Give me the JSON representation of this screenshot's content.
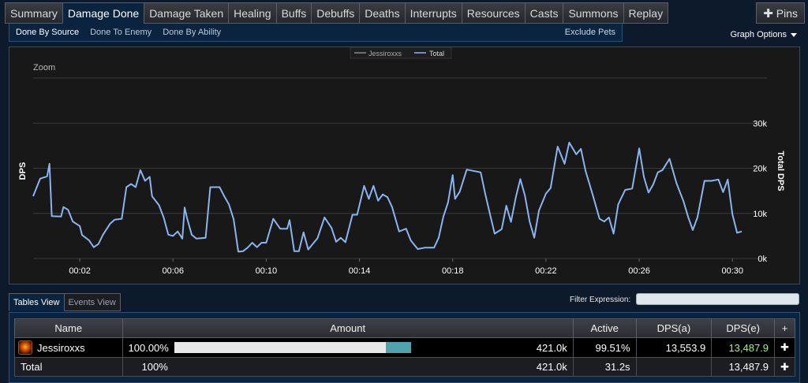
{
  "tabs": [
    "Summary",
    "Damage Done",
    "Damage Taken",
    "Healing",
    "Buffs",
    "Debuffs",
    "Deaths",
    "Interrupts",
    "Resources",
    "Casts",
    "Summons",
    "Replay"
  ],
  "active_tab": "Damage Done",
  "pins_label": "Pins",
  "subtabs": [
    "Done By Source",
    "Done To Enemy",
    "Done By Ability"
  ],
  "exclude_pets": "Exclude Pets",
  "graph_options": "Graph Options",
  "legend": [
    "Jessiroxxs",
    "Total"
  ],
  "zoom_label": "Zoom",
  "colors": {
    "total": "#8ab4f0",
    "jessiroxxs": "#888888",
    "accent": "#0a2440",
    "dps_e": "#a7f07a",
    "bar": "#4ea3ad"
  },
  "chart_data": {
    "type": "line",
    "ylabel": "DPS",
    "y2label": "Total DPS",
    "x_ticks": [
      "00:02",
      "00:06",
      "00:10",
      "00:14",
      "00:18",
      "00:22",
      "00:26",
      "00:30"
    ],
    "y_ticks": [
      "0k",
      "10k",
      "20k",
      "30k"
    ],
    "ylim": [
      0,
      40000
    ],
    "xlim": [
      0,
      30.5
    ],
    "series": [
      {
        "name": "Total",
        "points": [
          [
            0,
            13800
          ],
          [
            0.3,
            17700
          ],
          [
            0.6,
            18200
          ],
          [
            0.7,
            21000
          ],
          [
            0.8,
            9400
          ],
          [
            1.2,
            9300
          ],
          [
            1.3,
            11400
          ],
          [
            1.5,
            10800
          ],
          [
            1.7,
            8200
          ],
          [
            2.0,
            7200
          ],
          [
            2.1,
            5200
          ],
          [
            2.4,
            4000
          ],
          [
            2.6,
            2500
          ],
          [
            2.8,
            3200
          ],
          [
            3.0,
            5300
          ],
          [
            3.3,
            7700
          ],
          [
            3.5,
            8600
          ],
          [
            3.8,
            8800
          ],
          [
            4.0,
            15800
          ],
          [
            4.2,
            16500
          ],
          [
            4.4,
            15800
          ],
          [
            4.6,
            19600
          ],
          [
            4.8,
            17200
          ],
          [
            5.0,
            18100
          ],
          [
            5.1,
            13800
          ],
          [
            5.4,
            11800
          ],
          [
            5.6,
            9100
          ],
          [
            5.8,
            5300
          ],
          [
            6.0,
            5000
          ],
          [
            6.2,
            6000
          ],
          [
            6.4,
            4400
          ],
          [
            6.5,
            11300
          ],
          [
            6.6,
            9000
          ],
          [
            6.8,
            5300
          ],
          [
            7.0,
            4400
          ],
          [
            7.4,
            4600
          ],
          [
            7.6,
            15800
          ],
          [
            7.8,
            15800
          ],
          [
            8.0,
            15800
          ],
          [
            8.2,
            13800
          ],
          [
            8.4,
            12000
          ],
          [
            8.6,
            8700
          ],
          [
            8.8,
            1500
          ],
          [
            9.0,
            1600
          ],
          [
            9.2,
            2400
          ],
          [
            9.4,
            3500
          ],
          [
            9.6,
            2500
          ],
          [
            9.8,
            3500
          ],
          [
            10.0,
            3500
          ],
          [
            10.3,
            8800
          ],
          [
            10.6,
            6600
          ],
          [
            10.9,
            6600
          ],
          [
            11.0,
            8500
          ],
          [
            11.2,
            1600
          ],
          [
            11.4,
            1600
          ],
          [
            11.6,
            5800
          ],
          [
            11.8,
            2000
          ],
          [
            12.2,
            4500
          ],
          [
            12.5,
            9100
          ],
          [
            12.8,
            6800
          ],
          [
            13.0,
            3700
          ],
          [
            13.2,
            4600
          ],
          [
            13.4,
            3600
          ],
          [
            13.7,
            9700
          ],
          [
            13.9,
            9700
          ],
          [
            14.2,
            16100
          ],
          [
            14.4,
            13200
          ],
          [
            14.6,
            16100
          ],
          [
            14.8,
            12800
          ],
          [
            15.0,
            14200
          ],
          [
            15.2,
            13600
          ],
          [
            15.4,
            11400
          ],
          [
            15.7,
            6000
          ],
          [
            16.0,
            6600
          ],
          [
            16.2,
            4000
          ],
          [
            16.5,
            2100
          ],
          [
            16.8,
            2400
          ],
          [
            17.2,
            2400
          ],
          [
            17.4,
            4600
          ],
          [
            17.6,
            9300
          ],
          [
            17.8,
            12400
          ],
          [
            18.0,
            18500
          ],
          [
            18.1,
            13200
          ],
          [
            18.3,
            14800
          ],
          [
            18.6,
            19700
          ],
          [
            19.2,
            19100
          ],
          [
            19.4,
            14200
          ],
          [
            19.6,
            9800
          ],
          [
            19.8,
            5500
          ],
          [
            20.1,
            6500
          ],
          [
            20.3,
            11700
          ],
          [
            20.5,
            8100
          ],
          [
            20.7,
            13400
          ],
          [
            20.9,
            17600
          ],
          [
            21.1,
            13900
          ],
          [
            21.3,
            8200
          ],
          [
            21.5,
            4600
          ],
          [
            21.7,
            10600
          ],
          [
            22.0,
            14400
          ],
          [
            22.2,
            15600
          ],
          [
            22.5,
            24800
          ],
          [
            22.8,
            21000
          ],
          [
            23.0,
            25700
          ],
          [
            23.3,
            23100
          ],
          [
            23.5,
            24300
          ],
          [
            23.7,
            19400
          ],
          [
            24.0,
            14200
          ],
          [
            24.3,
            8800
          ],
          [
            24.5,
            8200
          ],
          [
            24.7,
            9100
          ],
          [
            24.9,
            5500
          ],
          [
            25.1,
            12000
          ],
          [
            25.4,
            15200
          ],
          [
            25.7,
            15500
          ],
          [
            26.0,
            24400
          ],
          [
            26.2,
            18100
          ],
          [
            26.4,
            14600
          ],
          [
            26.6,
            16400
          ],
          [
            26.8,
            19100
          ],
          [
            27.0,
            19600
          ],
          [
            27.3,
            22100
          ],
          [
            27.6,
            16700
          ],
          [
            27.9,
            12700
          ],
          [
            28.1,
            9200
          ],
          [
            28.3,
            6300
          ],
          [
            28.5,
            9100
          ],
          [
            28.8,
            17200
          ],
          [
            29.1,
            17200
          ],
          [
            29.4,
            17500
          ],
          [
            29.6,
            14700
          ],
          [
            29.8,
            17500
          ],
          [
            30.0,
            9800
          ],
          [
            30.2,
            5700
          ],
          [
            30.4,
            6000
          ]
        ]
      }
    ]
  },
  "view_tabs": [
    "Tables View",
    "Events View"
  ],
  "filter_label": "Filter Expression:",
  "filter_value": "",
  "table": {
    "headers": [
      "Name",
      "Amount",
      "Active",
      "DPS(a)",
      "DPS(e)",
      "+"
    ],
    "rows": [
      {
        "name": "Jessiroxxs",
        "percent": "100.00%",
        "amount": "421.0k",
        "active": "99.51%",
        "dps_a": "13,553.9",
        "dps_e": "13,487.9",
        "bar_fraction": 1.0
      }
    ],
    "total": {
      "name": "Total",
      "percent": "100%",
      "amount": "421.0k",
      "active": "31.2s",
      "dps_a": "",
      "dps_e": "13,487.9"
    }
  }
}
